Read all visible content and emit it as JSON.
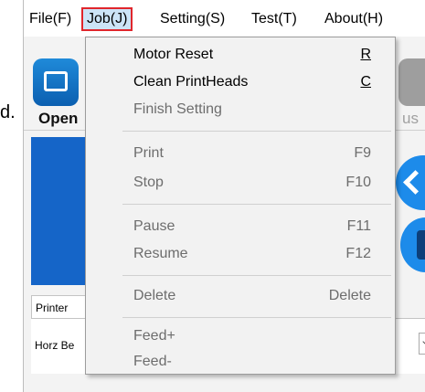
{
  "background": {
    "edge_text": "d."
  },
  "menubar": {
    "items": [
      {
        "label": "File(F)"
      },
      {
        "label": "Job(J)",
        "selected": true
      },
      {
        "label": "Setting(S)"
      },
      {
        "label": "Test(T)"
      },
      {
        "label": "About(H)"
      }
    ]
  },
  "toolbar": {
    "open_label": "Open",
    "right_label": "us"
  },
  "panel": {
    "printer_tab": "Printer",
    "horz_label": "Horz Be"
  },
  "job_menu": {
    "items": [
      {
        "label": "Motor Reset",
        "shortcut": "R",
        "enabled": true
      },
      {
        "label": "Clean PrintHeads",
        "shortcut": "C",
        "enabled": true
      },
      {
        "label": "Finish Setting",
        "shortcut": "",
        "enabled": false
      },
      {
        "label": "Print",
        "shortcut": "F9",
        "enabled": false
      },
      {
        "label": "Stop",
        "shortcut": "F10",
        "enabled": false
      },
      {
        "label": "Pause",
        "shortcut": "F11",
        "enabled": false
      },
      {
        "label": "Resume",
        "shortcut": "F12",
        "enabled": false
      },
      {
        "label": "Delete",
        "shortcut": "Delete",
        "enabled": false
      },
      {
        "label": "Feed+",
        "shortcut": "",
        "enabled": false
      },
      {
        "label": "Feed-",
        "shortcut": "",
        "enabled": false
      }
    ]
  },
  "colors": {
    "selected_highlight_border": "#e0262c",
    "menu_background": "#f2f2f2",
    "disabled_text": "#6d6d6d",
    "accent_blue": "#1565c8"
  }
}
